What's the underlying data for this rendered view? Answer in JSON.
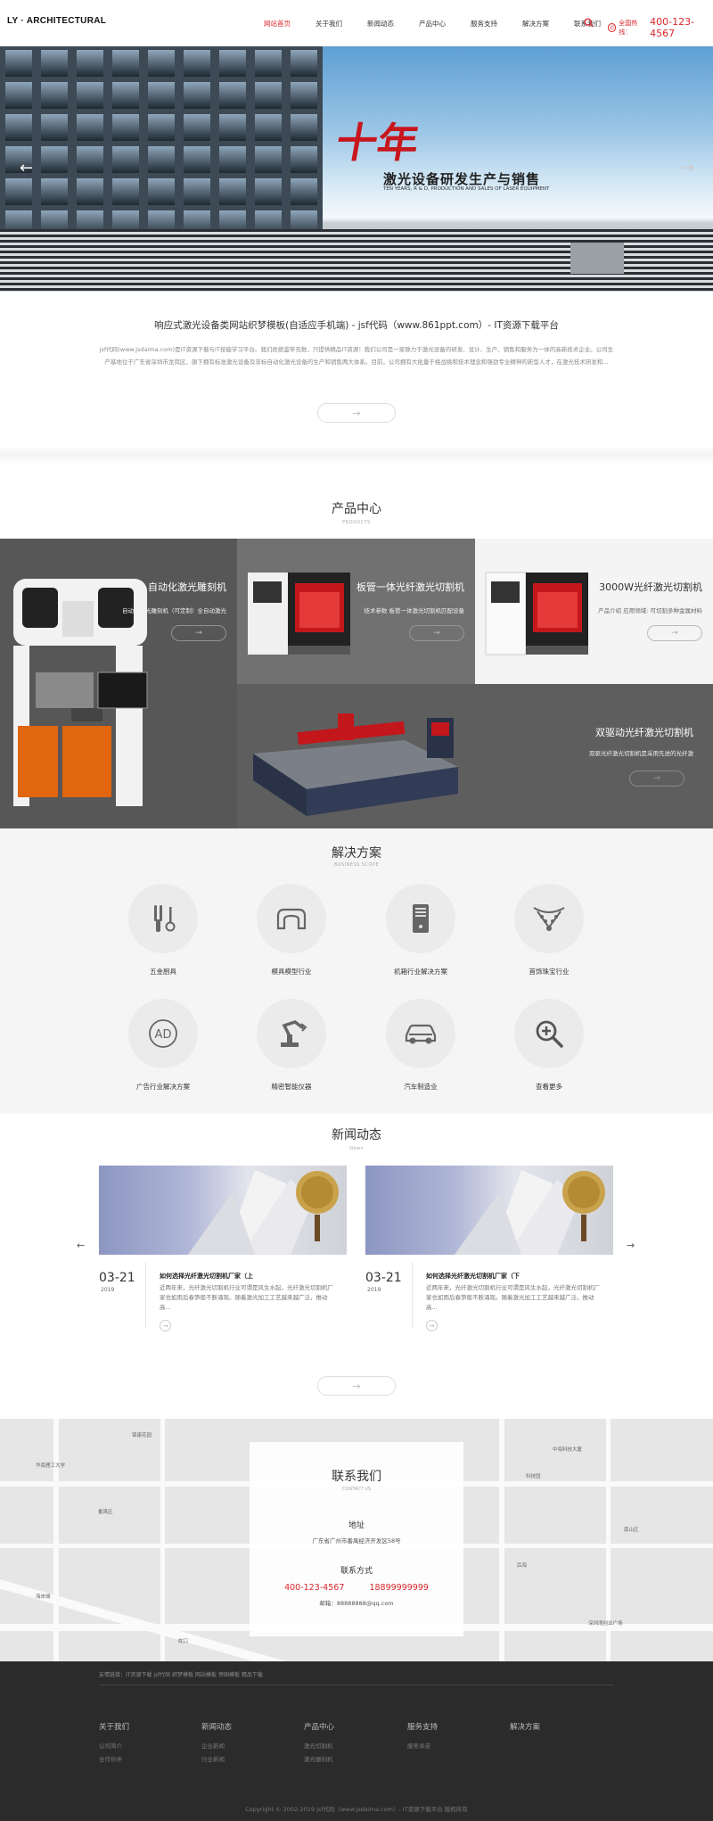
{
  "header": {
    "logo": "LY · ARCHITECTURAL",
    "nav": [
      "网站首页",
      "关于我们",
      "新闻动态",
      "产品中心",
      "服务支持",
      "解决方案",
      "联系我们"
    ],
    "active_nav": 0,
    "hotline_label": "全国热线：",
    "hotline_number": "400-123-4567"
  },
  "hero": {
    "big_char": "十年",
    "headline": "激光设备研发生产与销售",
    "sub": "TEN YEARS, R & D, PRODUCTION AND SALES OF LASER EQUIPMENT",
    "prev": "←",
    "next": "→"
  },
  "intro": {
    "title": "响应式激光设备类网站织梦模板(自适应手机端) - jsf代码（www.861ppt.com）- IT资源下载平台",
    "text": "jsf代码(www.jsdaima.com)是IT资源下载与IT技能学习平台。我们拒绝滥竽充数，只提供精品IT资源！我们公司是一家致力于激光设备的研发、设计、生产、销售和服务为一体的高新技术企业。公司生产基地位于广东省深圳市龙岗区，旗下拥有标准激光设备及非标自动化激光设备的生产和销售两大体系。目前，公司拥有大批量于挑战挑和技术理念和强劲专业精神的新型人才，在激光技术研发和...",
    "more": "→"
  },
  "products": {
    "title": "产品中心",
    "subtitle": "PRODUCTS",
    "items": [
      {
        "name": "自动化激光雕刻机",
        "desc": "自动化激光雕刻机（可定制）全自动激光",
        "more": "→"
      },
      {
        "name": "板管一体光纤激光切割机",
        "desc": "技术参数 板管一体激光切割机匹配设备",
        "more": "→"
      },
      {
        "name": "3000W光纤激光切割机",
        "desc": "产品介绍 应用领域: 可切割多种金属材料",
        "more": "→"
      },
      {
        "name": "双驱动光纤激光切割机",
        "desc": "双驱光纤激光切割机是采用先进的光纤激",
        "more": "→"
      }
    ]
  },
  "solutions": {
    "title": "解决方案",
    "subtitle": "BUSINESS SCOPE",
    "items": [
      {
        "label": "五金厨具",
        "icon": "kitchenware-icon"
      },
      {
        "label": "模具模型行业",
        "icon": "mold-icon"
      },
      {
        "label": "机箱行业解决方案",
        "icon": "chassis-icon"
      },
      {
        "label": "首饰珠宝行业",
        "icon": "jewelry-icon"
      },
      {
        "label": "广告行业解决方案",
        "icon": "ad-icon"
      },
      {
        "label": "精密智能仪器",
        "icon": "robot-arm-icon"
      },
      {
        "label": "汽车制造业",
        "icon": "car-icon"
      },
      {
        "label": "查看更多",
        "icon": "zoom-in-icon"
      }
    ]
  },
  "news": {
    "title": "新闻动态",
    "subtitle": "News",
    "items": [
      {
        "date": "03-21",
        "year": "2019",
        "headline": "如何选择光纤激光切割机厂家（上",
        "summary": "近两年来，光纤激光切割机行业可谓是风生水起，光纤激光切割机厂家也如雨后春笋般不断涌现。随着激光加工工艺越来越广泛，推动高...",
        "more": "→"
      },
      {
        "date": "03-21",
        "year": "2019",
        "headline": "如何选择光纤激光切割机厂家（下",
        "summary": "近两年来，光纤激光切割机行业可谓是风生水起，光纤激光切割机厂家也如雨后春笋般不断涌现。随着激光加工工艺越来越广泛，推动高...",
        "more": "→"
      }
    ],
    "prev": "←",
    "next": "→",
    "more": "→"
  },
  "contact": {
    "title": "联系我们",
    "subtitle": "CONTACT US",
    "address_label": "地址",
    "address": "广东省广州市番禺经济开发区58号",
    "method_label": "联系方式",
    "phone1": "400-123-4567",
    "phone2": "18899999999",
    "email": "邮箱：88888888@qq.com",
    "map_labels": [
      "锦康花园",
      "华南理工大学",
      "番禺区",
      "深圳湾创业广场",
      "科技园",
      "南山区",
      "海岸城",
      "后海",
      "蛇口",
      "中海科技大厦"
    ]
  },
  "footer": {
    "friend_links": "友情链接：IT资源下载 jsf代码 织梦模板 网站模板 帝国模板 精品下载",
    "columns": [
      {
        "title": "关于我们",
        "items": [
          "公司简介",
          "合作伙伴"
        ]
      },
      {
        "title": "新闻动态",
        "items": [
          "企业新闻",
          "行业新闻"
        ]
      },
      {
        "title": "产品中心",
        "items": [
          "激光切割机",
          "激光雕刻机"
        ]
      },
      {
        "title": "服务支持",
        "items": [
          "服务承诺"
        ]
      },
      {
        "title": "解决方案",
        "items": []
      }
    ],
    "copyright": "Copyright © 2002-2019 jsf代码（www.jsdaima.com）- IT资源下载平台 版权所有"
  },
  "colors": {
    "accent": "#d9252b",
    "footer_bg": "#2b2b2b"
  }
}
